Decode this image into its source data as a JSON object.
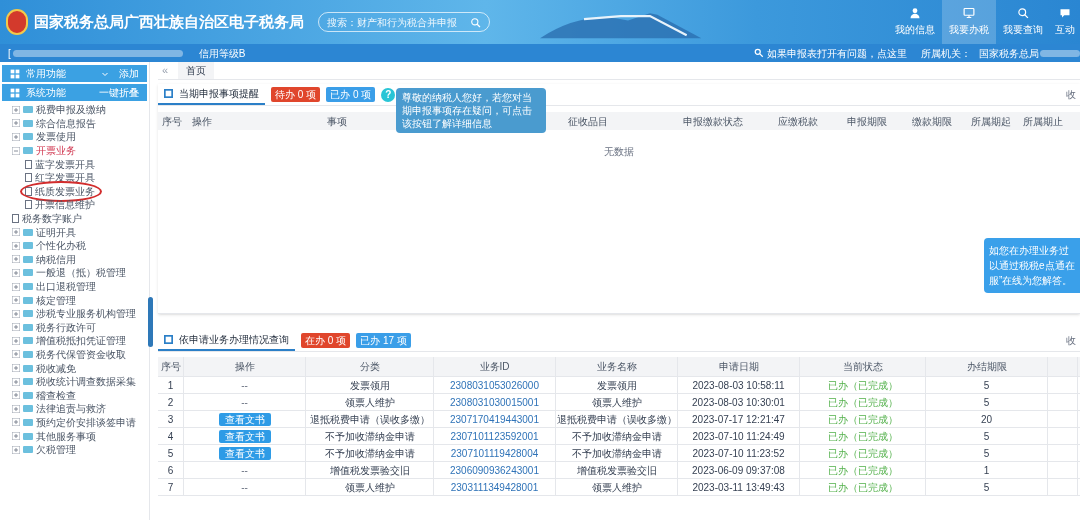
{
  "header": {
    "title": "国家税务总局广西壮族自治区电子税务局",
    "search": {
      "placeholder": "搜索：财产和行为税合并申报"
    },
    "nav": [
      {
        "label": "我的信息",
        "selected": false
      },
      {
        "label": "我要办税",
        "selected": true
      },
      {
        "label": "我要查询",
        "selected": false
      },
      {
        "label": "互动",
        "selected": false
      }
    ]
  },
  "subbar": {
    "bracket": "[",
    "credit": "信用等级B",
    "help_link": "如果申报表打开有问题，点这里",
    "authority_label": "所属机关：",
    "authority": "国家税务总局"
  },
  "sidebar": {
    "sections": [
      {
        "label": "常用功能",
        "action": "添加"
      },
      {
        "label": "系统功能",
        "action": "一键折叠"
      }
    ],
    "tree": [
      {
        "label": "税费申报及缴纳",
        "kind": "folder",
        "expanded": false
      },
      {
        "label": "综合信息报告",
        "kind": "folder",
        "expanded": false
      },
      {
        "label": "发票使用",
        "kind": "folder",
        "expanded": false
      },
      {
        "label": "开票业务",
        "kind": "folder",
        "expanded": true,
        "children": [
          {
            "label": "蓝字发票开具",
            "kind": "file",
            "annotated": false
          },
          {
            "label": "红字发票开具",
            "kind": "file",
            "annotated": false
          },
          {
            "label": "纸质发票业务",
            "kind": "file",
            "annotated": true
          },
          {
            "label": "开票信息维护",
            "kind": "file",
            "annotated": false
          }
        ]
      },
      {
        "label": "税务数字账户",
        "kind": "file",
        "expanded": false
      },
      {
        "label": "证明开具",
        "kind": "folder",
        "expanded": false
      },
      {
        "label": "个性化办税",
        "kind": "folder",
        "expanded": false
      },
      {
        "label": "纳税信用",
        "kind": "folder",
        "expanded": false
      },
      {
        "label": "一般退（抵）税管理",
        "kind": "folder",
        "expanded": false
      },
      {
        "label": "出口退税管理",
        "kind": "folder",
        "expanded": false
      },
      {
        "label": "核定管理",
        "kind": "folder",
        "expanded": false
      },
      {
        "label": "涉税专业服务机构管理",
        "kind": "folder",
        "expanded": false
      },
      {
        "label": "税务行政许可",
        "kind": "folder",
        "expanded": false
      },
      {
        "label": "增值税抵扣凭证管理",
        "kind": "folder",
        "expanded": false
      },
      {
        "label": "税务代保管资金收取",
        "kind": "folder",
        "expanded": false
      },
      {
        "label": "税收减免",
        "kind": "folder",
        "expanded": false
      },
      {
        "label": "税收统计调查数据采集",
        "kind": "folder",
        "expanded": false
      },
      {
        "label": "稽查检查",
        "kind": "folder",
        "expanded": false
      },
      {
        "label": "法律追责与救济",
        "kind": "folder",
        "expanded": false
      },
      {
        "label": "预约定价安排谈签申请",
        "kind": "folder",
        "expanded": false
      },
      {
        "label": "其他服务事项",
        "kind": "folder",
        "expanded": false
      },
      {
        "label": "欠税管理",
        "kind": "folder",
        "expanded": false
      }
    ]
  },
  "tabs": {
    "back": "«",
    "items": [
      {
        "label": "首页",
        "selected": true
      }
    ]
  },
  "reminder_panel": {
    "title": "当期申报事项提醒",
    "badges": [
      {
        "label": "待办 0 项",
        "color": "#e0462c"
      },
      {
        "label": "已办 0 项",
        "color": "#3a9ee8"
      }
    ],
    "help": "?",
    "collapse": "收",
    "tooltip": "尊敬的纳税人您好，若您对当期申报事项存在疑问，可点击该按钮了解详细信息",
    "columns": [
      "序号",
      "操作",
      "事项",
      "征收品目",
      "申报缴款状态",
      "应缴税款",
      "申报期限",
      "缴款期限",
      "所属期起",
      "所属期止"
    ],
    "empty": "无数据"
  },
  "chat_popup": [
    "如您在办理业务过",
    "以通过税税e点通在",
    "服”在线为您解答。"
  ],
  "apply_panel": {
    "title": "依申请业务办理情况查询",
    "badges": [
      {
        "label": "在办 0 项",
        "color": "#e0462c"
      },
      {
        "label": "已办 17 项",
        "color": "#3a9ee8"
      }
    ],
    "collapse": "收",
    "columns": [
      "序号",
      "操作",
      "分类",
      "业务ID",
      "业务名称",
      "申请日期",
      "当前状态",
      "办结期限"
    ],
    "rows": [
      {
        "no": "1",
        "action": {
          "kind": "text",
          "label": "--"
        },
        "category": "发票领用",
        "id": "2308031053026000",
        "name": "发票领用",
        "date": "2023-08-03 10:58:11",
        "status": "已办（已完成）",
        "deadline": "5"
      },
      {
        "no": "2",
        "action": {
          "kind": "text",
          "label": "--"
        },
        "category": "领票人维护",
        "id": "2308031030015001",
        "name": "领票人维护",
        "date": "2023-08-03 10:30:01",
        "status": "已办（已完成）",
        "deadline": "5"
      },
      {
        "no": "3",
        "action": {
          "kind": "button",
          "label": "查看文书"
        },
        "category": "退抵税费申请（误收多缴）",
        "id": "2307170419443001",
        "name": "退抵税费申请（误收多缴）",
        "date": "2023-07-17 12:21:47",
        "status": "已办（已完成）",
        "deadline": "20"
      },
      {
        "no": "4",
        "action": {
          "kind": "button",
          "label": "查看文书"
        },
        "category": "不予加收滞纳金申请",
        "id": "2307101123592001",
        "name": "不予加收滞纳金申请",
        "date": "2023-07-10 11:24:49",
        "status": "已办（已完成）",
        "deadline": "5"
      },
      {
        "no": "5",
        "action": {
          "kind": "button",
          "label": "查看文书"
        },
        "category": "不予加收滞纳金申请",
        "id": "2307101119428004",
        "name": "不予加收滞纳金申请",
        "date": "2023-07-10 11:23:52",
        "status": "已办（已完成）",
        "deadline": "5"
      },
      {
        "no": "6",
        "action": {
          "kind": "text",
          "label": "--"
        },
        "category": "增值税发票验交旧",
        "id": "2306090936243001",
        "name": "增值税发票验交旧",
        "date": "2023-06-09 09:37:08",
        "status": "已办（已完成）",
        "deadline": "1"
      },
      {
        "no": "7",
        "action": {
          "kind": "text",
          "label": "--"
        },
        "category": "领票人维护",
        "id": "2303111349428001",
        "name": "领票人维护",
        "date": "2023-03-11 13:49:43",
        "status": "已办（已完成）",
        "deadline": "5"
      }
    ]
  }
}
